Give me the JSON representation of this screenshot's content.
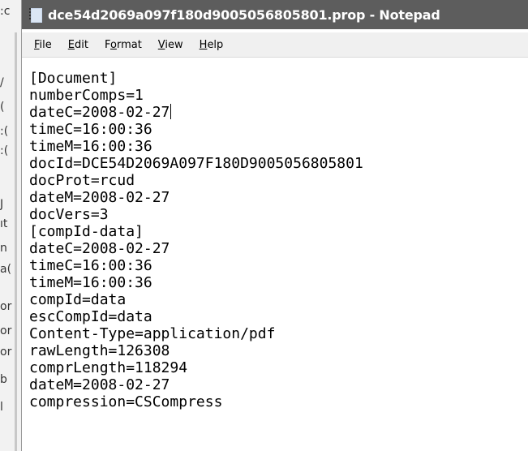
{
  "window": {
    "title": "dce54d2069a097f180d9005056805801.prop - Notepad",
    "app_icon": "notepad-icon"
  },
  "menu": [
    {
      "label": "File",
      "accel": "F",
      "rest": "ile"
    },
    {
      "label": "Edit",
      "accel": "E",
      "rest": "dit"
    },
    {
      "label": "Format",
      "pre": "F",
      "accel": "o",
      "rest": "rmat"
    },
    {
      "label": "View",
      "accel": "V",
      "rest": "iew"
    },
    {
      "label": "Help",
      "accel": "H",
      "rest": "elp"
    }
  ],
  "editor": {
    "lines": [
      "[Document]",
      "numberComps=1",
      "dateC=2008-02-27",
      "timeC=16:00:36",
      "timeM=16:00:36",
      "docId=DCE54D2069A097F180D9005056805801",
      "docProt=rcud",
      "dateM=2008-02-27",
      "docVers=3",
      "[compId-data]",
      "dateC=2008-02-27",
      "timeC=16:00:36",
      "timeM=16:00:36",
      "compId=data",
      "escCompId=data",
      "Content-Type=application/pdf",
      "rawLength=126308",
      "comprLength=118294",
      "dateM=2008-02-27",
      "compression=CSCompress"
    ],
    "caret_line": 2
  },
  "background_window": {
    "fragments": [
      ":c",
      "/",
      "( ",
      ":(",
      ":(",
      "J",
      "ıt",
      "n",
      "a(",
      "or",
      "or",
      "or",
      "b",
      "l"
    ]
  }
}
